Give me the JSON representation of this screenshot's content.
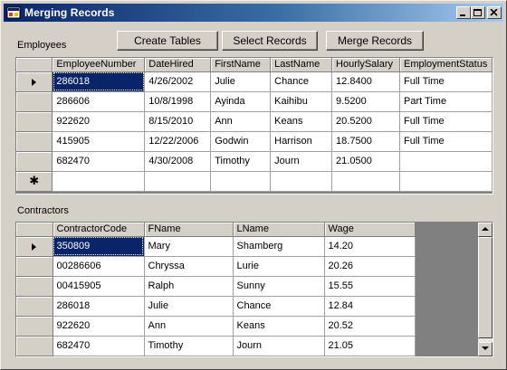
{
  "window": {
    "title": "Merging Records",
    "icon": "form-icon"
  },
  "toolbar": {
    "create_label": "Create Tables",
    "select_label": "Select Records",
    "merge_label": "Merge Records"
  },
  "employees": {
    "section_label": "Employees",
    "columns": [
      "EmployeeNumber",
      "DateHired",
      "FirstName",
      "LastName",
      "HourlySalary",
      "EmploymentStatus"
    ],
    "rows": [
      [
        "286018",
        "4/26/2002",
        "Julie",
        "Chance",
        "12.8400",
        "Full Time"
      ],
      [
        "286606",
        "10/8/1998",
        "Ayinda",
        "Kaihibu",
        "9.5200",
        "Part Time"
      ],
      [
        "922620",
        "8/15/2010",
        "Ann",
        "Keans",
        "20.5200",
        "Full Time"
      ],
      [
        "415905",
        "12/22/2006",
        "Godwin",
        "Harrison",
        "18.7500",
        "Full Time"
      ],
      [
        "682470",
        "4/30/2008",
        "Timothy",
        "Journ",
        "21.0500",
        ""
      ]
    ],
    "new_row_marker": "✱"
  },
  "contractors": {
    "section_label": "Contractors",
    "columns": [
      "ContractorCode",
      "FName",
      "LName",
      "Wage"
    ],
    "rows": [
      [
        "350809",
        "Mary",
        "Shamberg",
        "14.20"
      ],
      [
        "00286606",
        "Chryssa",
        "Lurie",
        "20.26"
      ],
      [
        "00415905",
        "Ralph",
        "Sunny",
        "15.55"
      ],
      [
        "286018",
        "Julie",
        "Chance",
        "12.84"
      ],
      [
        "922620",
        "Ann",
        "Keans",
        "20.52"
      ],
      [
        "682470",
        "Timothy",
        "Journ",
        "21.05"
      ]
    ]
  },
  "colors": {
    "titlebar_start": "#0a246a",
    "titlebar_end": "#a6caf0",
    "selection": "#0a246a",
    "face": "#d4d0c8",
    "grid_background": "#808080"
  }
}
